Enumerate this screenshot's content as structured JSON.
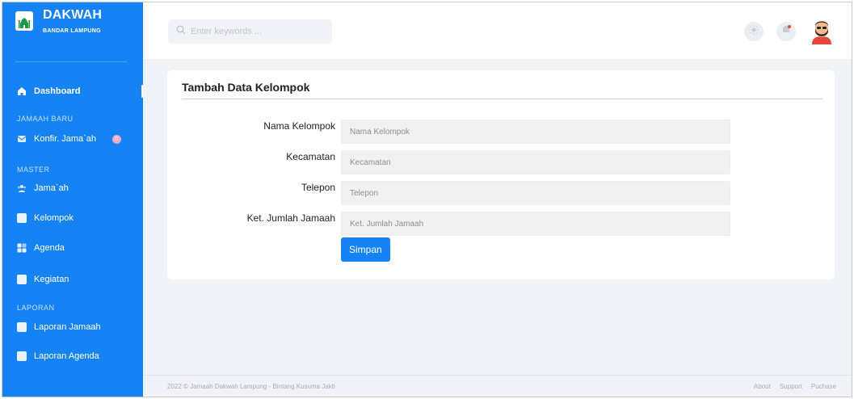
{
  "brand": {
    "title": "DAKWAH",
    "subtitle": "BANDAR LAMPUNG"
  },
  "sidebar": {
    "dashboard": "Dashboard",
    "heading_jamaah_baru": "JAMAAH BARU",
    "konfir": "Konfir. Jama`ah",
    "konfir_badge": "0",
    "heading_master": "MASTER",
    "jamaah": "Jama`ah",
    "kelompok": "Kelompok",
    "agenda": "Agenda",
    "kegiatan": "Kegiatan",
    "heading_laporan": "LAPORAN",
    "laporan_jamaah": "Laporan Jamaah",
    "laporan_agenda": "Laporan Agenda"
  },
  "topbar": {
    "search_placeholder": "Enter keywords ..."
  },
  "form": {
    "title": "Tambah Data Kelompok",
    "nama_label": "Nama Kelompok",
    "nama_placeholder": "Nama Kelompok",
    "kecamatan_label": "Kecamatan",
    "kecamatan_placeholder": "Kecamatan",
    "telepon_label": "Telepon",
    "telepon_placeholder": "Telepon",
    "jumlah_label": "Ket. Jumlah Jamaah",
    "jumlah_placeholder": "Ket. Jumlah Jamaah",
    "submit_label": "Simpan"
  },
  "footer": {
    "copyright": "2022 © Jamaah Dakwah Lampung - Bintang Kusuma Jakti",
    "links": [
      "About",
      "Support",
      "Puchase"
    ]
  },
  "colors": {
    "primary": "#1683f5",
    "background": "#f1f3f9",
    "notification_dot": "#f04438"
  }
}
